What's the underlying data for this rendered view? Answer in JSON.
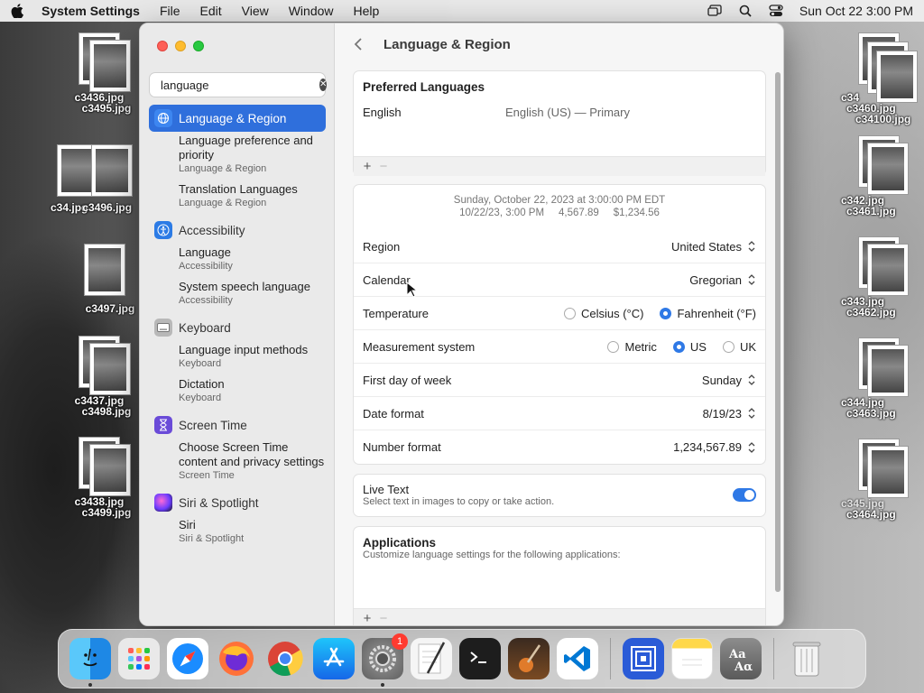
{
  "menubar": {
    "app_name": "System Settings",
    "menus": [
      "File",
      "Edit",
      "View",
      "Window",
      "Help"
    ],
    "datetime": "Sun Oct 22  3:00 PM"
  },
  "desktop": {
    "files": [
      {
        "labels": [
          "c3436.jpg",
          "c3495.jpg"
        ]
      },
      {
        "labels": [
          "c34.jpg",
          "c3496.jpg"
        ]
      },
      {
        "labels": [
          "c3497.jpg"
        ]
      },
      {
        "labels": [
          "c3437.jpg",
          "c3498.jpg"
        ]
      },
      {
        "labels": [
          "c3438.jpg",
          "c3499.jpg"
        ]
      },
      {
        "labels": [
          "c34",
          "c3460.jpg",
          "c34100.jpg"
        ]
      },
      {
        "labels": [
          "c342.jpg",
          "c3461.jpg"
        ]
      },
      {
        "labels": [
          "c343.jpg",
          "c3462.jpg"
        ]
      },
      {
        "labels": [
          "c344.jpg",
          "c3463.jpg"
        ]
      },
      {
        "labels": [
          "c345.jpg",
          "c3464.jpg"
        ]
      }
    ]
  },
  "sidebar": {
    "search_value": "language",
    "categories": [
      {
        "label": "Language & Region",
        "items": [
          {
            "title": "Language preference and priority",
            "caption": "Language & Region"
          },
          {
            "title": "Translation Languages",
            "caption": "Language & Region"
          }
        ]
      },
      {
        "label": "Accessibility",
        "items": [
          {
            "title": "Language",
            "caption": "Accessibility"
          },
          {
            "title": "System speech language",
            "caption": "Accessibility"
          }
        ]
      },
      {
        "label": "Keyboard",
        "items": [
          {
            "title": "Language input methods",
            "caption": "Keyboard"
          },
          {
            "title": "Dictation",
            "caption": "Keyboard"
          }
        ]
      },
      {
        "label": "Screen Time",
        "items": [
          {
            "title": "Choose Screen Time content and privacy settings",
            "caption": "Screen Time"
          }
        ]
      },
      {
        "label": "Siri & Spotlight",
        "items": [
          {
            "title": "Siri",
            "caption": "Siri & Spotlight"
          }
        ]
      }
    ]
  },
  "main": {
    "title": "Language & Region",
    "preferred": {
      "heading": "Preferred Languages",
      "language": "English",
      "detail": "English (US) — Primary",
      "plus": "+",
      "minus": "−"
    },
    "preview": {
      "line1": "Sunday, October 22, 2023 at 3:00:00 PM EDT",
      "line2": "10/22/23, 3:00 PM     4,567.89     $1,234.56"
    },
    "settings": {
      "region_label": "Region",
      "region_value": "United States",
      "calendar_label": "Calendar",
      "calendar_value": "Gregorian",
      "temperature_label": "Temperature",
      "temp_options": [
        "Celsius (°C)",
        "Fahrenheit (°F)"
      ],
      "temp_selected": 1,
      "measurement_label": "Measurement system",
      "measure_options": [
        "Metric",
        "US",
        "UK"
      ],
      "measure_selected": 1,
      "firstday_label": "First day of week",
      "firstday_value": "Sunday",
      "dateformat_label": "Date format",
      "dateformat_value": "8/19/23",
      "numberformat_label": "Number format",
      "numberformat_value": "1,234,567.89"
    },
    "live_text": {
      "title": "Live Text",
      "caption": "Select text in images to copy or take action.",
      "enabled": true
    },
    "applications": {
      "heading": "Applications",
      "caption": "Customize language settings for the following applications:",
      "plus": "+",
      "minus": "−"
    }
  },
  "dock": {
    "apps": [
      "Finder",
      "Launchpad",
      "Safari",
      "Firefox",
      "Chrome",
      "App Store",
      "System Settings",
      "TextEdit",
      "Terminal",
      "GarageBand",
      "Visual Studio Code",
      "Screens",
      "Notes",
      "Dictionary",
      "Trash"
    ],
    "settings_badge": "1"
  },
  "colors": {
    "accent": "#2f6fdc",
    "toggle_on": "#2f79e6"
  }
}
